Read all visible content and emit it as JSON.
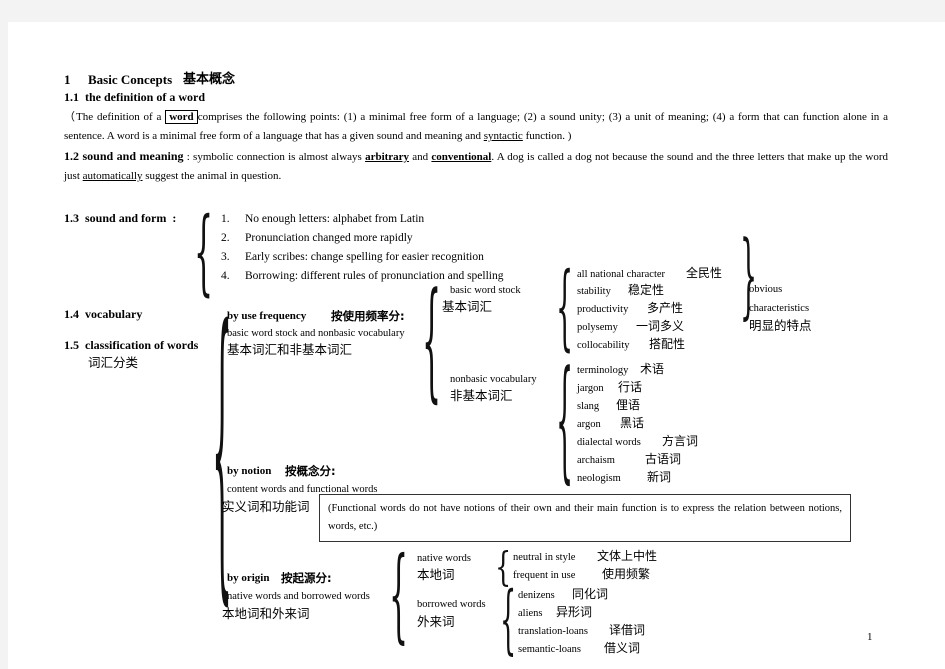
{
  "document": {
    "page_number": "1",
    "heading": {
      "number": "1",
      "title_en": "Basic Concepts",
      "title_cn": "基本概念"
    },
    "sections": {
      "s11": {
        "label": "1.1  the definition of a word",
        "body_pre": "（The definition of a ",
        "body_boxed": "word",
        "body_post": "comprises the following points: (1) a minimal free form of a language; (2) a sound unity; (3) a unit of meaning; (4) a form that can function alone in a sentence. A word is a minimal free form of a language that has a given sound and meaning and ",
        "body_underlined": "syntactic",
        "body_tail": " function.  )"
      },
      "s12": {
        "label": "1.2  sound and meaning",
        "body_pre": " : symbolic connection is almost always ",
        "bold_u_1": "arbitrary",
        "mid1": " and ",
        "bold_u_2": "conventional",
        "mid2": ". A dog is called a dog not because the sound and the three letters that make up the word just ",
        "underlined": "automatically",
        "tail": " suggest the animal in question."
      },
      "s13": {
        "label": "1.3  sound and form  :",
        "items": [
          {
            "num": "1.",
            "text": "No enough letters: alphabet from Latin"
          },
          {
            "num": "2.",
            "text": "Pronunciation changed more rapidly"
          },
          {
            "num": "3.",
            "text": "Early scribes: change spelling for easier recognition"
          },
          {
            "num": "4.",
            "text": "Borrowing: different rules of pronunciation and spelling"
          }
        ]
      },
      "s14": {
        "label": "1.4  vocabulary"
      },
      "s15": {
        "label": "1.5  classification of words",
        "label_cn": "词汇分类"
      }
    },
    "branches": {
      "by_frequency": {
        "title_en": "by use frequency",
        "title_cn": "按使用频率分:",
        "sub_en": "basic word stock and nonbasic vocabulary",
        "sub_cn": "基本词汇和非基本词汇",
        "basic": {
          "en": "basic word stock",
          "cn": "基本词汇"
        },
        "basic_features": [
          {
            "en": "all national character",
            "cn": "全民性"
          },
          {
            "en": "stability",
            "cn": "稳定性"
          },
          {
            "en": "productivity",
            "cn": "多产性"
          },
          {
            "en": "polysemy",
            "cn": "一词多义"
          },
          {
            "en": "collocability",
            "cn": "搭配性"
          }
        ],
        "features_summary": {
          "en1": "obvious",
          "en2": "characteristics",
          "cn": "明显的特点"
        },
        "nonbasic": {
          "en": "nonbasic vocabulary",
          "cn": "非基本词汇"
        },
        "nonbasic_items": [
          {
            "en": "terminology",
            "cn": "术语"
          },
          {
            "en": "jargon",
            "cn": "行话"
          },
          {
            "en": "slang",
            "cn": "俚语"
          },
          {
            "en": "argon",
            "cn": "黑话"
          },
          {
            "en": "dialectal words",
            "cn": "方言词"
          },
          {
            "en": "archaism",
            "cn": "古语词"
          },
          {
            "en": "neologism",
            "cn": "新词"
          }
        ]
      },
      "by_notion": {
        "title_en": "by notion",
        "title_cn": "按概念分:",
        "sub_en": "content words and functional words",
        "sub_cn": "实义词和功能词",
        "note": "(Functional words do not have notions of their own and their main function is to express the relation between notions, words, etc.)"
      },
      "by_origin": {
        "title_en": "by origin",
        "title_cn": "按起源分:",
        "sub_en": "native words and borrowed words",
        "sub_cn": "本地词和外来词",
        "native": {
          "en": "native words",
          "cn": "本地词"
        },
        "native_features": [
          {
            "en": "neutral in style",
            "cn": "文体上中性"
          },
          {
            "en": "frequent in use",
            "cn": "使用频繁"
          }
        ],
        "borrowed": {
          "en": "borrowed words",
          "cn": "外来词"
        },
        "borrowed_items": [
          {
            "en": "denizens",
            "cn": "同化词"
          },
          {
            "en": "aliens",
            "cn": "异形词"
          },
          {
            "en": "translation-loans",
            "cn": "译借词"
          },
          {
            "en": "semantic-loans",
            "cn": "借义词"
          }
        ]
      }
    }
  }
}
